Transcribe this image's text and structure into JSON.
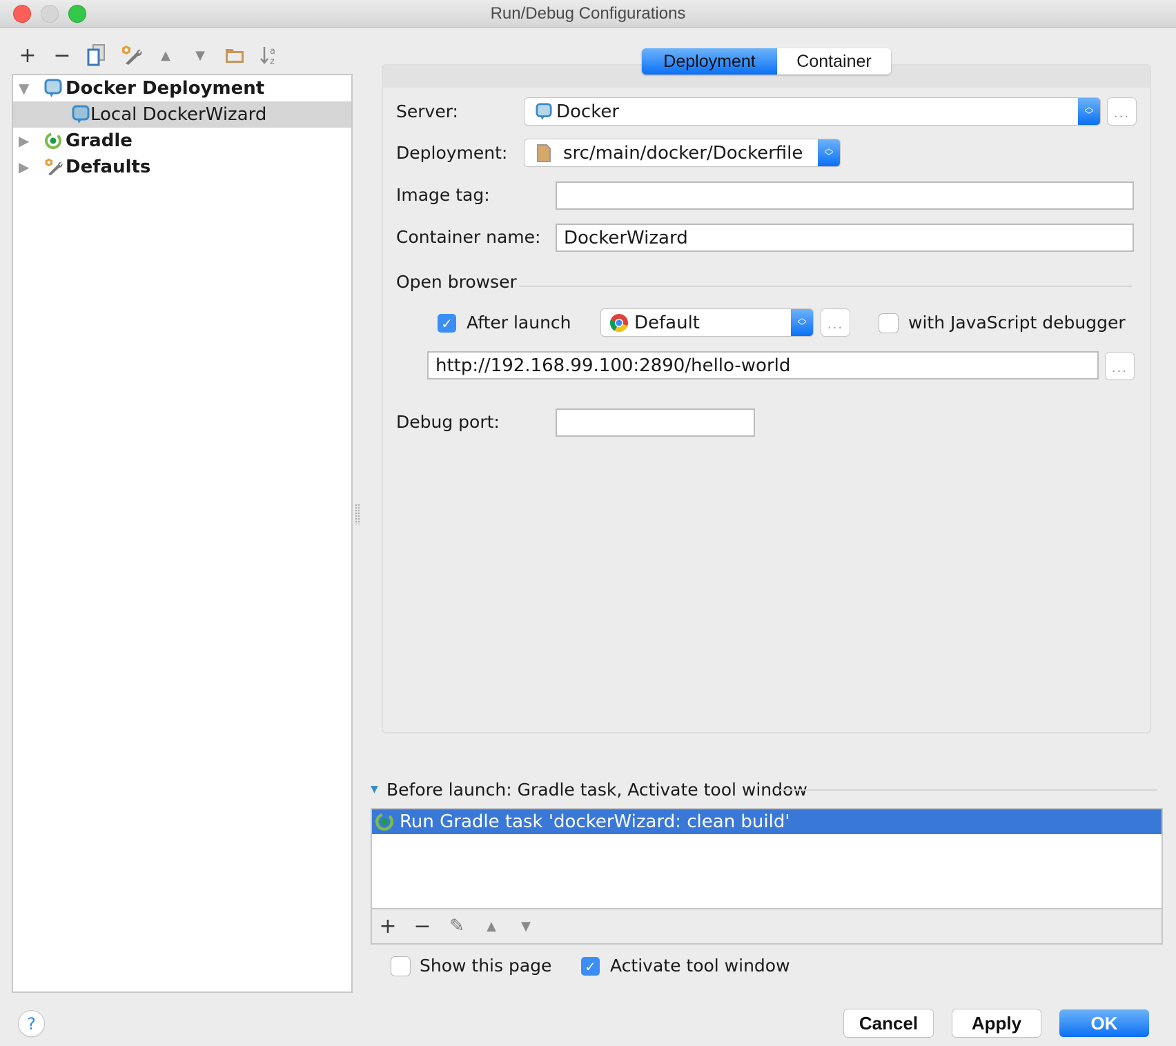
{
  "window": {
    "title": "Run/Debug Configurations",
    "traffic_lights": {
      "close": "#fc5f57",
      "minimize": "#d6d6d6",
      "zoom": "#34c84a"
    }
  },
  "toolbar": {
    "items": [
      {
        "icon": "plus-icon",
        "glyph": "+"
      },
      {
        "icon": "minus-icon",
        "glyph": "−"
      },
      {
        "icon": "copy-icon",
        "glyph": ""
      },
      {
        "icon": "wrench-icon",
        "glyph": ""
      },
      {
        "icon": "move-up-icon",
        "glyph": "▲"
      },
      {
        "icon": "move-down-icon",
        "glyph": "▼"
      },
      {
        "icon": "folder-icon",
        "glyph": ""
      },
      {
        "icon": "sort-alpha-icon",
        "glyph": "↓ᵃ𝗓"
      }
    ]
  },
  "tree": {
    "items": [
      {
        "label": "Docker Deployment",
        "expanded": true,
        "level": 0,
        "icon": "docker-icon"
      },
      {
        "label": "Local DockerWizard",
        "level": 1,
        "selected": true,
        "icon": "docker-icon"
      },
      {
        "label": "Gradle",
        "expanded": false,
        "level": 0,
        "icon": "gradle-icon"
      },
      {
        "label": "Defaults",
        "expanded": false,
        "level": 0,
        "icon": "wrench-icon"
      }
    ]
  },
  "tabs": [
    {
      "label": "Deployment",
      "active": true
    },
    {
      "label": "Container",
      "active": false
    }
  ],
  "form": {
    "server_label": "Server:",
    "server_value": "Docker",
    "deployment_label": "Deployment:",
    "deployment_value": "src/main/docker/Dockerfile",
    "image_tag_label": "Image tag:",
    "image_tag_value": "",
    "container_name_label": "Container name:",
    "container_name_value": "DockerWizard",
    "open_browser_label": "Open browser",
    "after_launch_label": "After launch",
    "after_launch_checked": true,
    "browser_value": "Default",
    "js_debugger_label": "with JavaScript debugger",
    "js_debugger_checked": false,
    "url_value": "http://192.168.99.100:2890/hello-world",
    "debug_port_label": "Debug port:",
    "debug_port_value": "",
    "ellipsis": "..."
  },
  "before_launch": {
    "header": "Before launch: Gradle task, Activate tool window",
    "tasks": [
      "Run Gradle task 'dockerWizard: clean build'"
    ],
    "toolbar": [
      "+",
      "−",
      "✎",
      "▲",
      "▼"
    ]
  },
  "options": {
    "show_this_page_label": "Show this page",
    "show_this_page_checked": false,
    "activate_tool_window_label": "Activate tool window",
    "activate_tool_window_checked": true
  },
  "buttons": {
    "help": "?",
    "cancel": "Cancel",
    "apply": "Apply",
    "ok": "OK"
  },
  "colors": {
    "accent": "#0a70f5",
    "selection": "#3a78d8",
    "tree_selection": "#d5d5d5"
  }
}
